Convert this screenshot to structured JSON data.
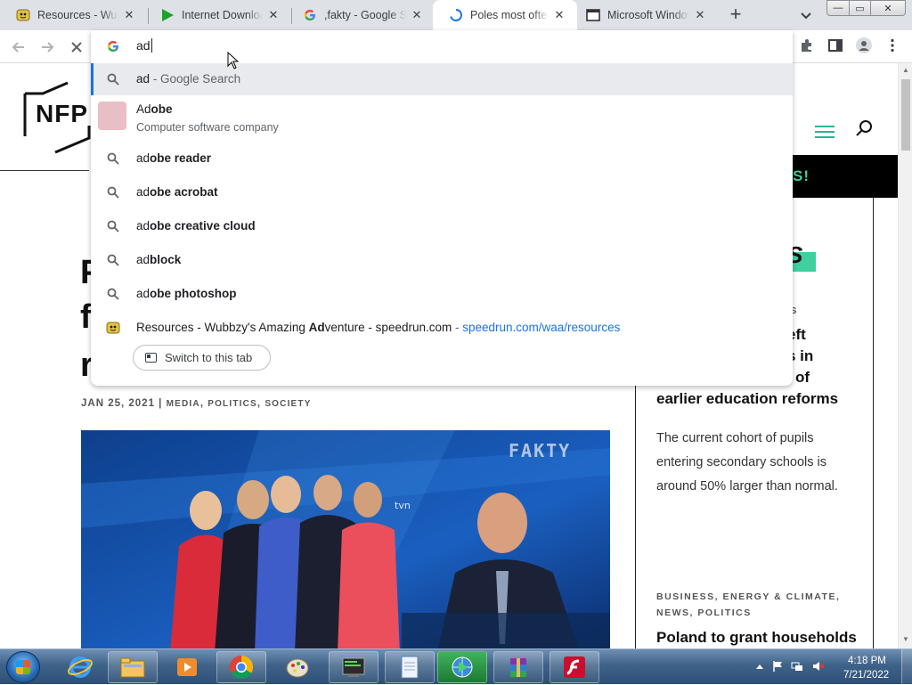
{
  "tabs": [
    {
      "title": "Resources - Wubbzy",
      "favicon": "wubbzy-favicon-icon",
      "active": false
    },
    {
      "title": "Internet Download",
      "favicon": "idm-play-icon",
      "active": false
    },
    {
      "title": ",fakty - Google Se",
      "favicon": "google-g-icon",
      "active": false
    },
    {
      "title": "Poles most often",
      "favicon": "loading-spinner-icon",
      "active": true
    },
    {
      "title": "Microsoft Window",
      "favicon": "microsoft-window-icon",
      "active": false
    }
  ],
  "tab_controls": {
    "new_tab": "+",
    "tab_search": "chevron-down-icon",
    "close": "✕"
  },
  "window": {
    "minimize": "—",
    "restore": "▭",
    "close": "✕"
  },
  "omnibox": {
    "input": "ad",
    "suggestions": [
      {
        "kind": "search",
        "typed": "ad",
        "rest": "",
        "suffix": " - Google Search",
        "selected": true
      },
      {
        "kind": "entity",
        "typed": "Ad",
        "rest": "obe",
        "subtitle": "Computer software company"
      },
      {
        "kind": "search",
        "typed": "ad",
        "rest": "obe reader"
      },
      {
        "kind": "search",
        "typed": "ad",
        "rest": "obe acrobat"
      },
      {
        "kind": "search",
        "typed": "ad",
        "rest": "obe creative cloud"
      },
      {
        "kind": "search",
        "typed": "ad",
        "rest": "block"
      },
      {
        "kind": "search",
        "typed": "ad",
        "rest": "obe photoshop"
      },
      {
        "kind": "tab",
        "before": "Resources - Wubbzy's Amazing ",
        "bold": "Ad",
        "after": "venture - speedrun.com",
        "sep": " - ",
        "url": "speedrun.com/waa/resources",
        "button": "Switch to this tab"
      }
    ]
  },
  "page": {
    "logo": "NFP",
    "banner": "S!",
    "title_fragments": [
      "P",
      "f",
      "r"
    ],
    "meta": {
      "date": "JAN 25, 2021",
      "sep": " | ",
      "cats": [
        "MEDIA",
        "POLITICS",
        "SOCIETY"
      ]
    },
    "hero_watermark": "FAKTY",
    "hero_logo": "tvn",
    "sidebar": {
      "accent_letter": "S",
      "kicker1": "TICS",
      "head1_lines": [
        "eft",
        "s in",
        "of",
        "earlier education reforms"
      ],
      "desc": "The current cohort of pupils entering secondary schools is around 50% larger than normal.",
      "kicker2_line1": "BUSINESS, ENERGY & CLIMATE,",
      "kicker2_line2": "NEWS, POLITICS",
      "head2": "Poland to grant households"
    }
  },
  "taskbar": {
    "items": [
      "ie-icon",
      "explorer-folder-icon",
      "media-player-icon",
      "chrome-icon",
      "paint-icon",
      "terminal-icon",
      "notepad-icon",
      "idm-globe-icon",
      "winrar-icon",
      "flash-icon"
    ],
    "clock_time": "4:18 PM",
    "clock_date": "7/21/2022"
  },
  "colors": {
    "accent": "#3ed19f",
    "omnibox_highlight": "#1a73e8",
    "url": "#1a73e8"
  }
}
